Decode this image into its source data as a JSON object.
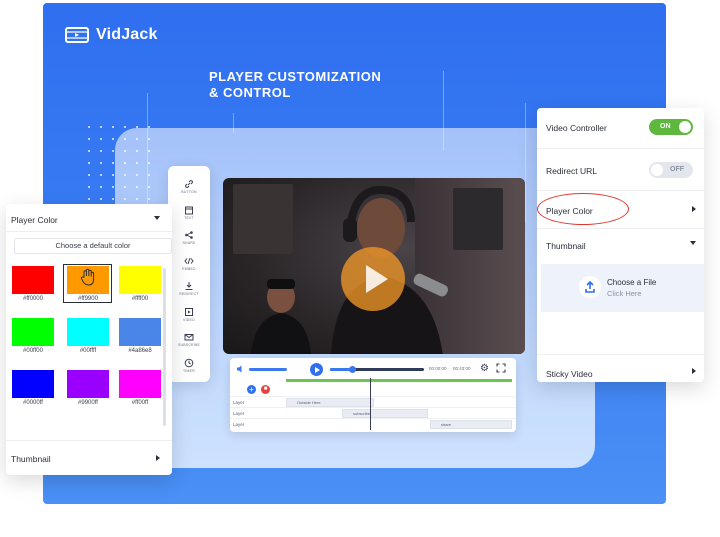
{
  "brand": {
    "name": "VidJack"
  },
  "headline": {
    "line1": "PLAYER CUSTOMIZATION",
    "line2": "& CONTROL"
  },
  "toolbar": {
    "items": [
      {
        "label": "BUTTON",
        "icon": "link-icon"
      },
      {
        "label": "TEXT",
        "icon": "calendar-icon"
      },
      {
        "label": "SHARE",
        "icon": "share-icon"
      },
      {
        "label": "EMBED",
        "icon": "code-icon"
      },
      {
        "label": "REDIRECT",
        "icon": "download-icon"
      },
      {
        "label": "VIDEO",
        "icon": "play-square-icon"
      },
      {
        "label": "SUBSCRIBE",
        "icon": "mail-icon"
      },
      {
        "label": "TIMER",
        "icon": "clock-icon"
      }
    ]
  },
  "player": {
    "time_current": "00:00:00",
    "time_total": "00:43:00",
    "progress": 0.23,
    "tracks": [
      {
        "label": "Layer",
        "segment": "Outside Here"
      },
      {
        "label": "Layer",
        "segment": "subscribe"
      },
      {
        "label": "Layer",
        "segment": "share"
      }
    ]
  },
  "color_panel": {
    "title": "Player Color",
    "default_button": "Choose a default color",
    "swatches": [
      {
        "hex": "#ff0000",
        "label": "#ff0000"
      },
      {
        "hex": "#ff9900",
        "label": "#ff9900"
      },
      {
        "hex": "#ffff00",
        "label": "#ffff00"
      },
      {
        "hex": "#00ff00",
        "label": "#00ff00"
      },
      {
        "hex": "#00ffff",
        "label": "#00ffff"
      },
      {
        "hex": "#4a86e8",
        "label": "#4a86e8"
      },
      {
        "hex": "#0000ff",
        "label": "#0000ff"
      },
      {
        "hex": "#9900ff",
        "label": "#9900ff"
      },
      {
        "hex": "#ff00ff",
        "label": "#ff00ff"
      }
    ],
    "selected": "#ff9900",
    "thumbnail_label": "Thumbnail"
  },
  "settings_panel": {
    "video_controller": {
      "label": "Video Controller",
      "state": "ON"
    },
    "redirect_url": {
      "label": "Redirect URL",
      "state": "OFF"
    },
    "player_color": "Player Color",
    "thumbnail": "Thumbnail",
    "choose_file": "Choose a File",
    "click_here": "Click Here",
    "sticky_video": "Sticky Video"
  },
  "colors": {
    "accent": "#2f6ff0",
    "toggle_on": "#5fb83e",
    "highlight": "#e0382e",
    "play": "#f0962a"
  }
}
